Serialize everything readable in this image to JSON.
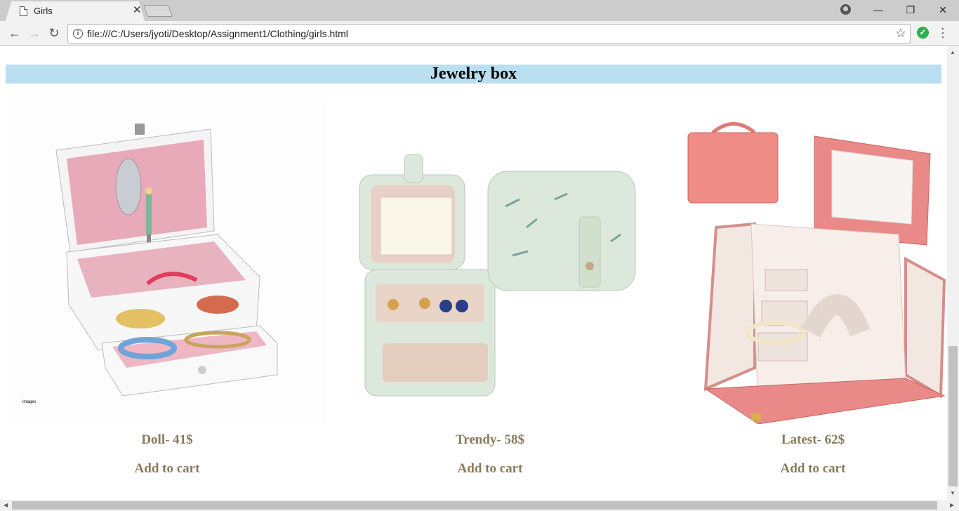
{
  "browser": {
    "tab_title": "Girls",
    "url": "file:///C:/Users/jyoti/Desktop/Assignment1/Clothing/girls.html"
  },
  "page": {
    "section_title": "Jewelry box",
    "products": [
      {
        "name": "Doll- 41$",
        "cart_label": "Add to cart",
        "image_caption": "images"
      },
      {
        "name": "Trendy- 58$",
        "cart_label": "Add to cart"
      },
      {
        "name": "Latest- 62$",
        "cart_label": "Add to cart"
      }
    ]
  },
  "colors": {
    "section_bar": "#b9dff0",
    "product_text": "#8a7a5c",
    "extension_ok": "#2bb24c"
  }
}
